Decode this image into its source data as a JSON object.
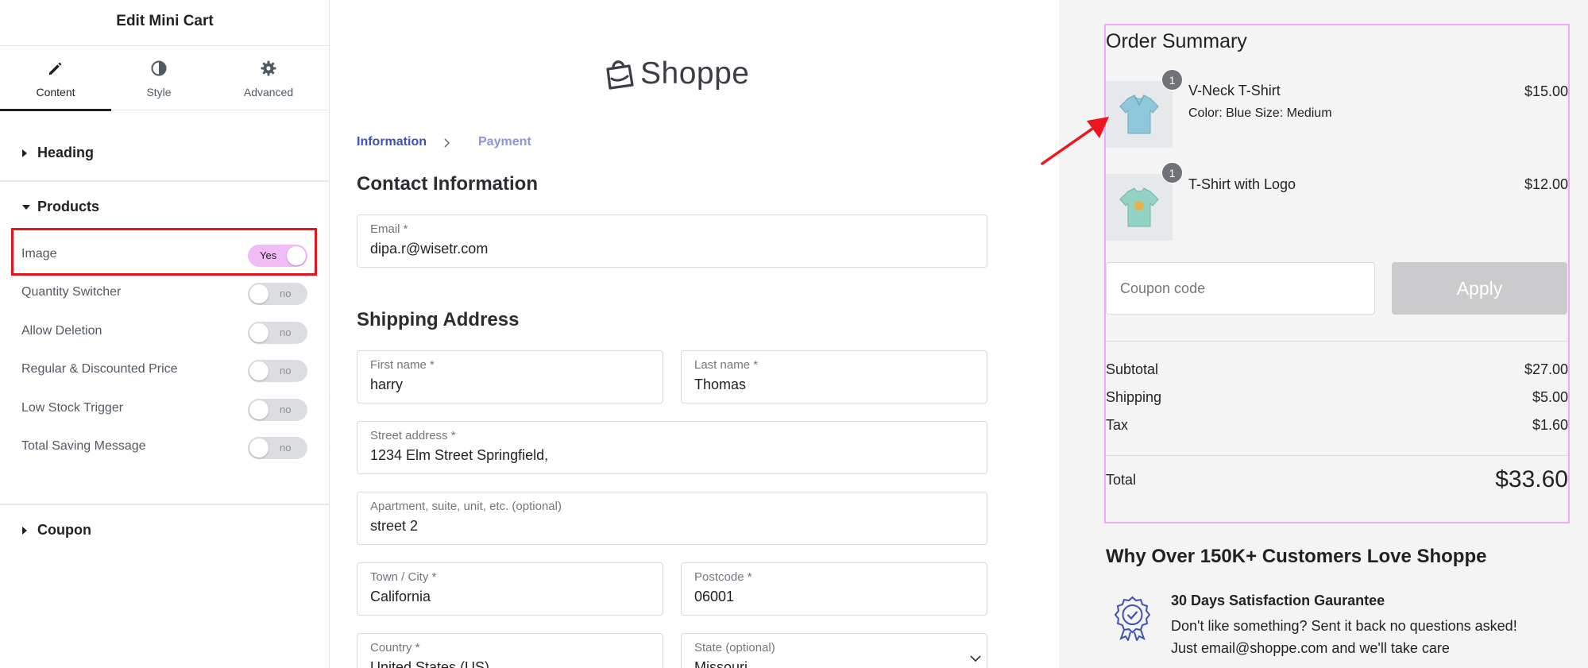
{
  "panel": {
    "title": "Edit Mini Cart",
    "tabs": [
      {
        "label": "Content",
        "icon": "pencil-icon",
        "active": true
      },
      {
        "label": "Style",
        "icon": "half-circle-icon",
        "active": false
      },
      {
        "label": "Advanced",
        "icon": "gear-icon",
        "active": false
      }
    ],
    "sections": {
      "heading": "Heading",
      "products": "Products",
      "coupon": "Coupon"
    },
    "controls": [
      {
        "label": "Image",
        "state": "Yes",
        "on": true
      },
      {
        "label": "Quantity Switcher",
        "state": "no",
        "on": false
      },
      {
        "label": "Allow Deletion",
        "state": "no",
        "on": false
      },
      {
        "label": "Regular & Discounted Price",
        "state": "no",
        "on": false
      },
      {
        "label": "Low Stock Trigger",
        "state": "no",
        "on": false
      },
      {
        "label": "Total Saving Message",
        "state": "no",
        "on": false
      }
    ]
  },
  "checkout": {
    "logo": "Shoppe",
    "breadcrumb": {
      "step1": "Information",
      "step2": "Payment"
    },
    "contact_heading": "Contact Information",
    "shipping_heading": "Shipping Address",
    "fields": {
      "email": {
        "label": "Email *",
        "value": "dipa.r@wisetr.com"
      },
      "first_name": {
        "label": "First name *",
        "value": "harry"
      },
      "last_name": {
        "label": "Last name *",
        "value": "Thomas"
      },
      "street": {
        "label": "Street address *",
        "value": "1234 Elm Street Springfield,"
      },
      "apartment": {
        "label": "Apartment, suite, unit, etc. (optional)",
        "value": "street 2"
      },
      "city": {
        "label": "Town / City *",
        "value": "California"
      },
      "postcode": {
        "label": "Postcode *",
        "value": "06001"
      },
      "country": {
        "label": "Country *",
        "value": "United States (US)"
      },
      "state": {
        "label": "State (optional)",
        "value": "Missouri"
      }
    }
  },
  "summary": {
    "title": "Order Summary",
    "items": [
      {
        "name": "V-Neck T-Shirt",
        "meta": "Color:  Blue Size:  Medium",
        "price": "$15.00",
        "qty": "1",
        "color": "#8fc7db"
      },
      {
        "name": "T-Shirt with Logo",
        "meta": "",
        "price": "$12.00",
        "qty": "1",
        "color": "#93d3c4"
      }
    ],
    "coupon_placeholder": "Coupon code",
    "apply_label": "Apply",
    "subtotal_label": "Subtotal",
    "subtotal": "$27.00",
    "shipping_label": "Shipping",
    "shipping": "$5.00",
    "tax_label": "Tax",
    "tax": "$1.60",
    "total_label": "Total",
    "total": "$33.60"
  },
  "trust": {
    "heading": "Why Over 150K+ Customers Love Shoppe",
    "guarantee_title": "30 Days Satisfaction Gaurantee",
    "guarantee_line1": "Don't like something? Sent it back no questions asked!",
    "guarantee_line2": "Just email@shoppe.com and we'll take care"
  },
  "colors": {
    "accent": "#3f51b5",
    "toggle_on": "#efbcf6",
    "highlight": "#e3141c",
    "summary_border": "#f1a9f8"
  }
}
